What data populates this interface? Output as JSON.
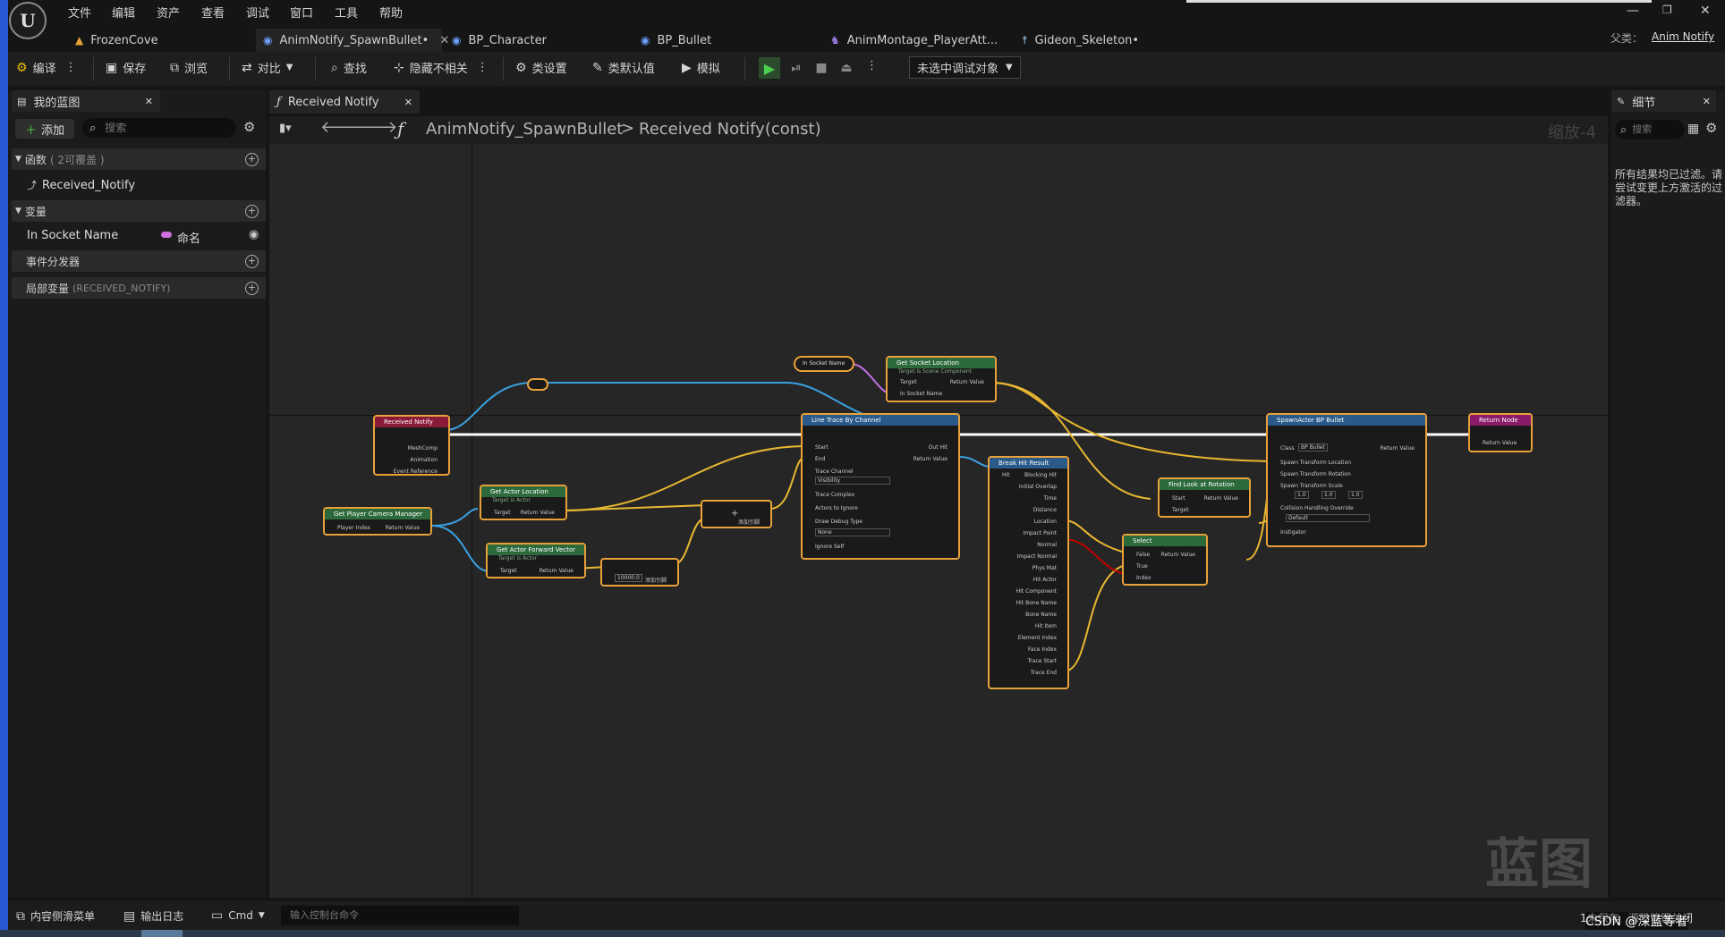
{
  "menu": [
    "文件",
    "编辑",
    "资产",
    "查看",
    "调试",
    "窗口",
    "工具",
    "帮助"
  ],
  "logo": "U",
  "tabs": [
    {
      "label": "FrozenCove"
    },
    {
      "label": "AnimNotify_SpawnBullet•"
    },
    {
      "label": "BP_Character"
    },
    {
      "label": "BP_Bullet"
    },
    {
      "label": "AnimMontage_PlayerAtt..."
    },
    {
      "label": "Gideon_Skeleton•"
    }
  ],
  "parent_class": {
    "label": "父类：",
    "value": "Anim Notify"
  },
  "toolbar": {
    "compile": "编译",
    "save": "保存",
    "browse": "浏览",
    "diff": "对比",
    "find": "查找",
    "hide_unrelated": "隐藏不相关",
    "class_settings": "类设置",
    "class_defaults": "类默认值",
    "simulate": "模拟",
    "debug_object": "未选中调试对象"
  },
  "left_panel": {
    "tab": "我的蓝图",
    "add": "添加",
    "search_placeholder": "搜索",
    "functions": "函数",
    "functions_note": "( 2可覆盖 )",
    "func_item": "Received_Notify",
    "variables": "变量",
    "var_name": "In Socket Name",
    "var_type": "命名",
    "dispatchers": "事件分发器",
    "local_vars": "局部变量",
    "local_vars_note": "(RECEIVED_NOTIFY)"
  },
  "graph": {
    "tab": "Received Notify",
    "breadcrumb_root": "AnimNotify_SpawnBullet",
    "breadcrumb_sep": ">",
    "breadcrumb_leaf": "Received Notify(const)",
    "zoom": "缩放-4",
    "watermark": "蓝图"
  },
  "right_panel": {
    "tab": "细节",
    "search_placeholder": "搜索",
    "empty_msg": "所有结果均已过滤。请尝试变更上方激活的过滤器。"
  },
  "bottom": {
    "content_drawer": "内容侧滑菜单",
    "output_log": "输出日志",
    "cmd": "Cmd",
    "console_placeholder": "输入控制台命令",
    "unsaved": "1未保存",
    "source": "源码管理关闭"
  },
  "credit": "CSDN @深蓝等者",
  "nodes": {
    "received_notify": {
      "title": "Received Notify",
      "pins": [
        "MeshComp",
        "Animation",
        "Event Reference"
      ]
    },
    "get_player_cam": {
      "title": "Get Player Camera Manager",
      "pins": [
        "Player Index",
        "Return Value"
      ]
    },
    "get_actor_loc": {
      "title": "Get Actor Location",
      "sub": "Target is Actor",
      "pins": [
        "Target",
        "Return Value"
      ]
    },
    "get_actor_fwd": {
      "title": "Get Actor Forward Vector",
      "sub": "Target is Actor",
      "pins": [
        "Target",
        "Return Value"
      ]
    },
    "multiply": {
      "label": "添加引脚",
      "value": "10000.0"
    },
    "add": {
      "label": "添加引脚"
    },
    "in_socket": {
      "title": "In Socket Name"
    },
    "get_socket_loc": {
      "title": "Get Socket Location",
      "sub": "Target is Scene Component",
      "pins": [
        "Target",
        "In Socket Name",
        "Return Value"
      ]
    },
    "line_trace": {
      "title": "Line Trace By Channel",
      "pins": [
        "Start",
        "End",
        "Trace Channel",
        "Visibility",
        "Trace Complex",
        "Actors to Ignore",
        "Draw Debug Type",
        "None",
        "Ignore Self",
        "Out Hit",
        "Return Value"
      ]
    },
    "break_hit": {
      "title": "Break Hit Result",
      "pins": [
        "Hit",
        "Blocking Hit",
        "Initial Overlap",
        "Time",
        "Distance",
        "Location",
        "Impact Point",
        "Normal",
        "Impact Normal",
        "Phys Mat",
        "Hit Actor",
        "Hit Component",
        "Hit Bone Name",
        "Bone Name",
        "Hit Item",
        "Element Index",
        "Face Index",
        "Trace Start",
        "Trace End"
      ]
    },
    "find_look": {
      "title": "Find Look at Rotation",
      "pins": [
        "Start",
        "Target",
        "Return Value"
      ]
    },
    "select": {
      "title": "Select",
      "pins": [
        "False",
        "True",
        "Index",
        "Return Value"
      ]
    },
    "spawn_actor": {
      "title": "SpawnActor BP Bullet",
      "pins": [
        "Class",
        "BP Bullet",
        "Spawn Transform Location",
        "Spawn Transform Rotation",
        "Spawn Transform Scale",
        "Collision Handling Override",
        "Default",
        "Instigator",
        "Return Value"
      ],
      "scale": [
        "1.0",
        "1.0",
        "1.0"
      ]
    },
    "return_node": {
      "title": "Return Node",
      "pins": [
        "Return Value"
      ]
    }
  },
  "colors": {
    "accent": "#e8a13a",
    "exec": "#ffffff",
    "vector": "#f2c230",
    "object": "#2c9fe0",
    "name": "#d070e0",
    "bool": "#c00000",
    "panel": "#1b1b1b",
    "graph": "#262626",
    "edge": "#2b58d6"
  }
}
